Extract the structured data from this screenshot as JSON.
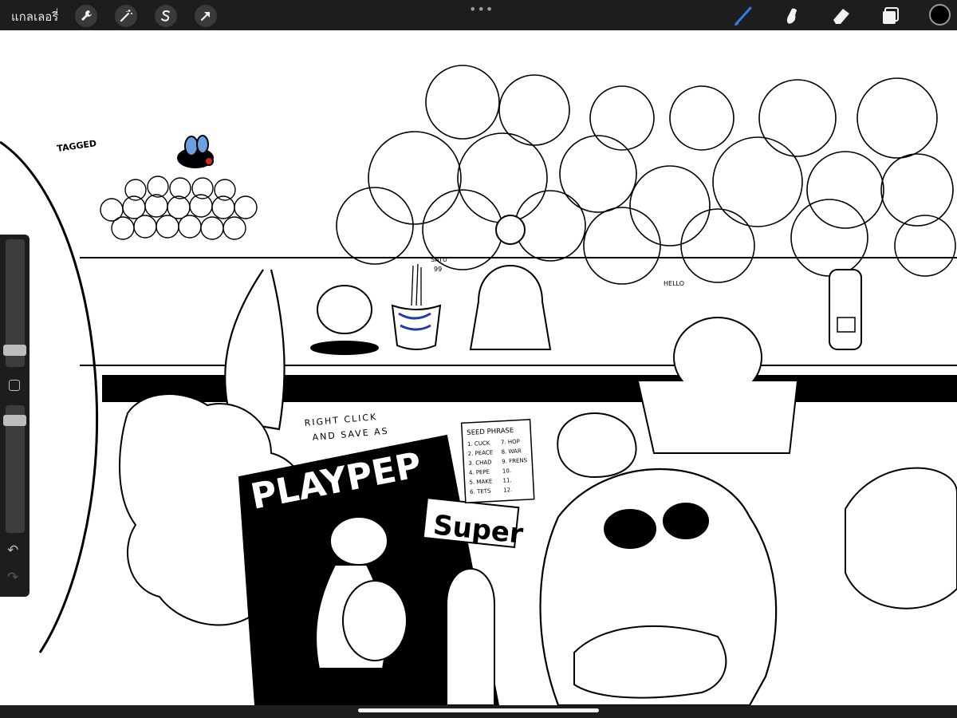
{
  "app": {
    "gallery_label": "แกลเลอรี่",
    "more_dots": "•••"
  },
  "toolbar_left": [
    {
      "name": "actions-wrench-icon"
    },
    {
      "name": "adjustments-wand-icon"
    },
    {
      "name": "selection-s-icon"
    },
    {
      "name": "transform-arrow-icon"
    }
  ],
  "toolbar_right": [
    {
      "name": "brush-icon",
      "active": true
    },
    {
      "name": "smudge-icon"
    },
    {
      "name": "eraser-icon"
    },
    {
      "name": "layers-icon"
    }
  ],
  "colors": {
    "bar": "#1d1d1f",
    "active_tool": "#2f7fe0",
    "current_color": "#000000"
  },
  "sidebar": {
    "brush_size_level": 0.3,
    "brush_opacity_level": 0.7,
    "undo": "↶",
    "redo": "↷"
  },
  "artwork_text": {
    "magazine_title": "PLAYPEP",
    "sticker": "Super",
    "note_line1": "RIGHT CLICK",
    "note_line2": "AND SAVE AS",
    "seed_title": "SEED PHRASE",
    "seed_col1": [
      "1. CUCK",
      "2. PEACE",
      "3. CHAD",
      "4. PEPE",
      "5. MAKE",
      "6. TETS"
    ],
    "seed_col2": [
      "7. HOP",
      "8. WAR",
      "9. FRENS",
      "10.",
      "11.",
      "12."
    ],
    "satu_label": "SATU",
    "satu_num": "99",
    "hello_label": "HELLO",
    "tagged_label": "TAGGED"
  }
}
